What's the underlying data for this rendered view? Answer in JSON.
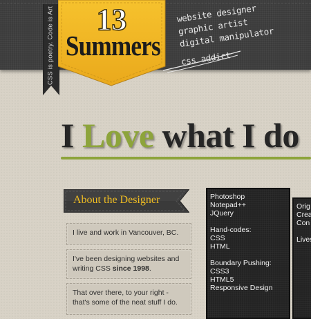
{
  "header": {
    "side_ribbon_text": "CSS is poetry.  Code is Art",
    "logo_number": "13",
    "logo_word": "Summers",
    "taglines": [
      "website designer",
      "graphic artist",
      "digital manipulator",
      "css addict"
    ]
  },
  "hero": {
    "before": "I ",
    "accent": "Love",
    "after": " what I do"
  },
  "about": {
    "title": "About the Designer",
    "cards": [
      {
        "text": "I live and work in Vancouver, BC."
      },
      {
        "text_before": "I've been designing websites and writing CSS ",
        "bold": "since 1998",
        "text_after": "."
      },
      {
        "text": "That over there, to your right - that's some of the neat stuff I do."
      }
    ]
  },
  "skills": {
    "software": [
      "Photoshop",
      "Notepad++",
      "JQuery"
    ],
    "hand_codes_label": "Hand-codes:",
    "hand_codes": [
      "CSS",
      "HTML"
    ],
    "boundary_label": "Boundary Pushing:",
    "boundary": [
      "CSS3",
      "HTML5",
      "Responsive Design"
    ]
  },
  "right_box": {
    "lines": [
      "Orig",
      "Crea",
      "Con",
      "",
      "Lives"
    ]
  },
  "colors": {
    "accent_green": "#8da43b",
    "logo_yellow": "#f3b824",
    "ribbon_gold_text": "#f0bd22",
    "header_dark": "#3c3c3c"
  }
}
